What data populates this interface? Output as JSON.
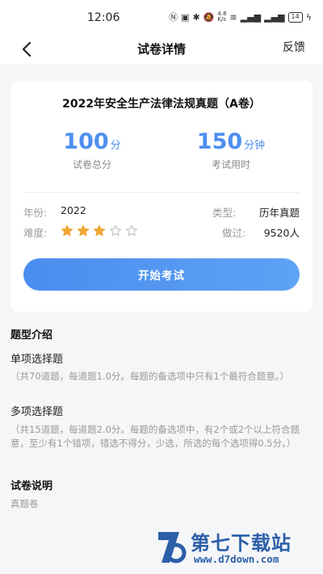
{
  "status_bar": {
    "time": "12:06",
    "net_speed": "4.8\nK/s",
    "battery": "14"
  },
  "nav": {
    "title": "试卷详情",
    "feedback_label": "反馈"
  },
  "paper": {
    "title": "2022年安全生产法律法规真题（A卷）",
    "total_score": "100",
    "total_score_unit": "分",
    "total_score_label": "试卷总分",
    "duration": "150",
    "duration_unit": "分钟",
    "duration_label": "考试用时",
    "year_label": "年份:",
    "year_value": "2022",
    "type_label": "类型:",
    "type_value": "历年真题",
    "difficulty_label": "难度:",
    "difficulty_stars": 3,
    "difficulty_max": 5,
    "done_label": "做过:",
    "done_value": "9520人",
    "start_button": "开始考试",
    "accent_color": "#4d8ff0"
  },
  "intro": {
    "heading": "题型介绍",
    "sections": [
      {
        "name": "单项选择题",
        "description": "（共70道题，每道题1.0分。每题的备选项中只有1个最符合题意。）"
      },
      {
        "name": "多项选择题",
        "description": "（共15道题，每道题2.0分。每题的备选项中，有2个或2个以上符合题意，至少有1个错项，错选不得分，少选，所选的每个选项得0.5分。）"
      }
    ]
  },
  "notes": {
    "heading": "试卷说明",
    "text": "真题卷"
  },
  "watermark": {
    "title": "第七下载站",
    "url": "www.d7down.com"
  }
}
